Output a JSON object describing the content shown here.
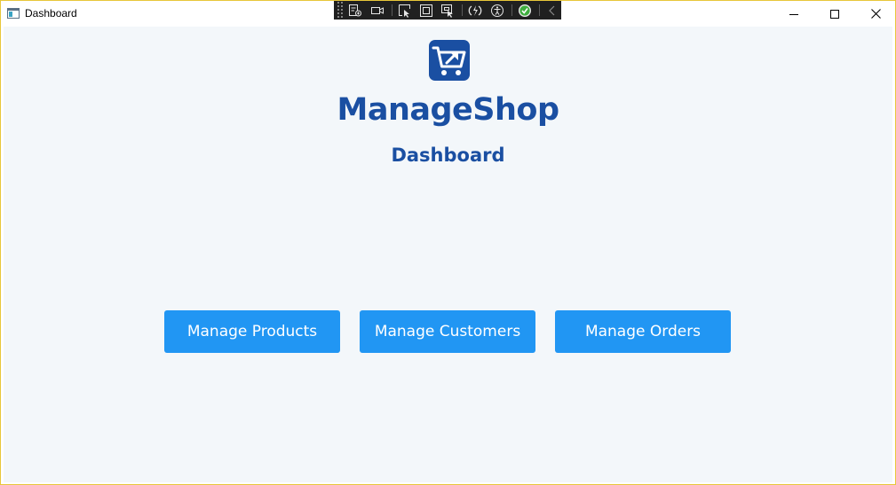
{
  "window": {
    "title": "Dashboard",
    "controls": {
      "minimize": "minimize-icon",
      "maximize": "maximize-icon",
      "close": "close-icon"
    },
    "border_color": "#e8c73a"
  },
  "debug_toolbar": {
    "tools": [
      "live-visual-tree-icon",
      "record-icon",
      "select-element-icon",
      "display-layout-adorners-icon",
      "track-focus-icon",
      "hot-reload-icon",
      "accessibility-icon",
      "binding-failures-ok-icon",
      "collapse-icon"
    ]
  },
  "main": {
    "logo": "shopping-cart-logo-icon",
    "brand": "ManageShop",
    "subtitle": "Dashboard",
    "buttons": [
      {
        "label": "Manage Products"
      },
      {
        "label": "Manage Customers"
      },
      {
        "label": "Manage Orders"
      }
    ]
  },
  "colors": {
    "accent": "#2196f3",
    "heading": "#1a4fa2",
    "background": "#f3f7fa"
  }
}
